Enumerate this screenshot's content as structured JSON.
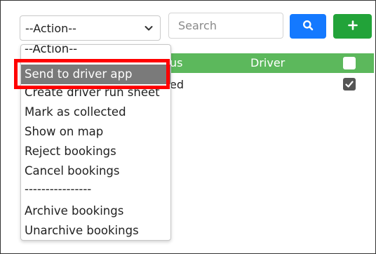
{
  "toolbar": {
    "action_select_value": "--Action--",
    "search_placeholder": "Search",
    "search_icon": "search-icon",
    "add_icon": "plus-icon",
    "search_button_color": "#1479ff",
    "add_button_color": "#22a339"
  },
  "table": {
    "header_color": "#5cb85c",
    "columns": {
      "status_partial": "us",
      "driver": "Driver"
    },
    "rows": [
      {
        "status_partial": "ed",
        "checked": true
      }
    ]
  },
  "dropdown": {
    "options": [
      "--Action--",
      "Send to driver app",
      "Create driver run sheet",
      "Mark as collected",
      "Show on map",
      "Reject bookings",
      "Cancel bookings",
      "----------------",
      "Archive bookings",
      "Unarchive bookings"
    ],
    "highlighted_index": 1,
    "highlight_color": "#7a7a7a",
    "annotation_color": "#ff0000"
  }
}
